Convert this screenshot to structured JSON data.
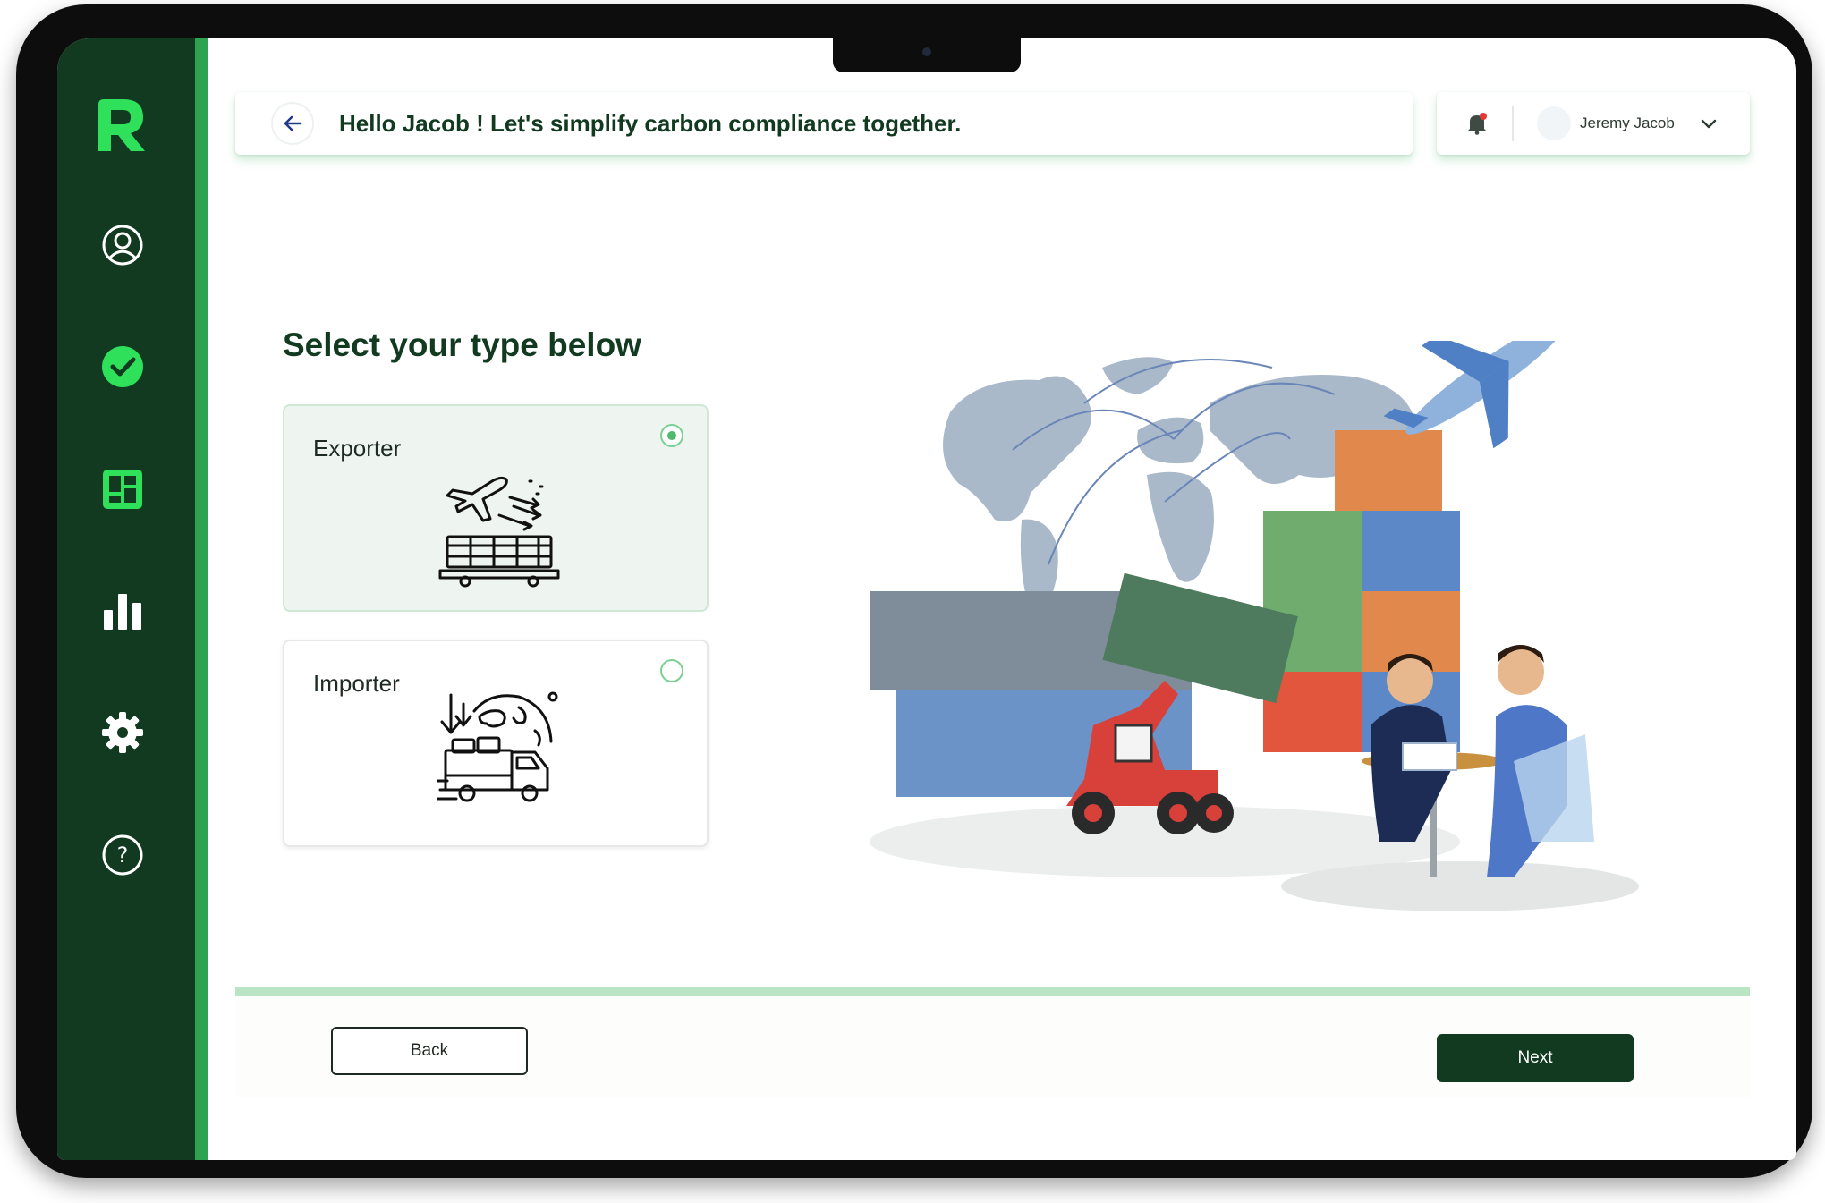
{
  "header": {
    "greeting": "Hello Jacob ! Let's simplify carbon compliance together."
  },
  "user": {
    "name": "Jeremy Jacob"
  },
  "main": {
    "title": "Select your type below",
    "options": [
      {
        "label": "Exporter",
        "selected": true,
        "icon": "cargo-plane-icon"
      },
      {
        "label": "Importer",
        "selected": false,
        "icon": "globe-delivery-truck-icon"
      }
    ]
  },
  "footer": {
    "back_label": "Back",
    "next_label": "Next"
  },
  "sidebar": {
    "items": [
      {
        "icon": "profile-icon"
      },
      {
        "icon": "check-circle-icon"
      },
      {
        "icon": "dashboard-icon"
      },
      {
        "icon": "bar-chart-icon"
      },
      {
        "icon": "gear-icon"
      },
      {
        "icon": "help-icon"
      }
    ]
  },
  "colors": {
    "sidebar_bg": "#113a20",
    "accent": "#2ea34f",
    "primary_button": "#113a20",
    "selected_card_bg": "#eef5f0"
  }
}
